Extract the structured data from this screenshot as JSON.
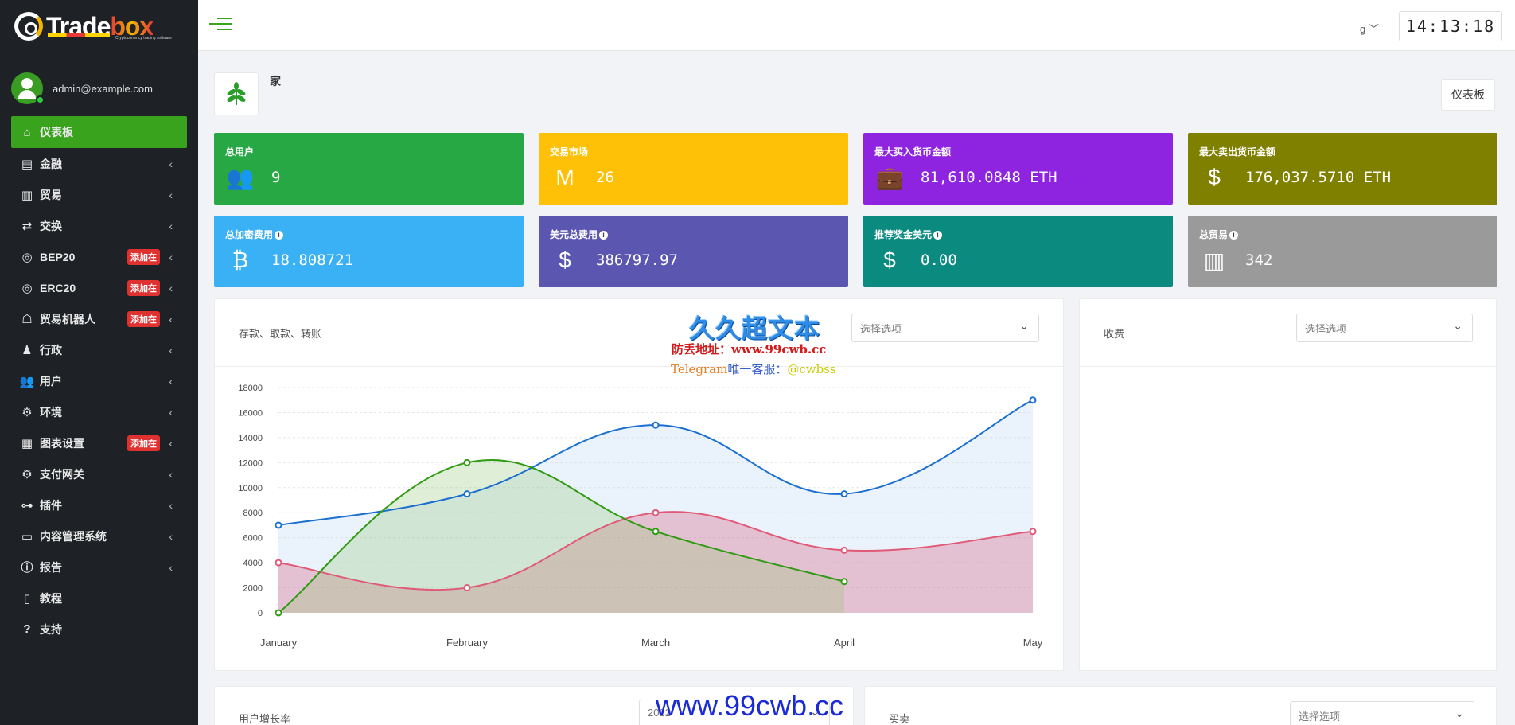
{
  "brand": {
    "name_part1": "Trade",
    "name_part2": "box",
    "tagline": "Cryptocurrency trading software"
  },
  "user": {
    "email": "admin@example.com"
  },
  "sidebar": {
    "items": [
      {
        "label": "仪表板",
        "icon": "home-icon",
        "badge": "",
        "active": true
      },
      {
        "label": "金融",
        "icon": "wallet-icon",
        "badge": ""
      },
      {
        "label": "贸易",
        "icon": "chart-bar-icon",
        "badge": ""
      },
      {
        "label": "交换",
        "icon": "exchange-icon",
        "badge": ""
      },
      {
        "label": "BEP20",
        "icon": "coins-icon",
        "badge": "添加在"
      },
      {
        "label": "ERC20",
        "icon": "coins-icon",
        "badge": "添加在"
      },
      {
        "label": "贸易机器人",
        "icon": "robot-icon",
        "badge": "添加在"
      },
      {
        "label": "行政",
        "icon": "user-tie-icon",
        "badge": ""
      },
      {
        "label": "用户",
        "icon": "users-icon",
        "badge": ""
      },
      {
        "label": "环境",
        "icon": "gear-icon",
        "badge": ""
      },
      {
        "label": "图表设置",
        "icon": "chart-icon",
        "badge": "添加在"
      },
      {
        "label": "支付网关",
        "icon": "cogs-icon",
        "badge": ""
      },
      {
        "label": "插件",
        "icon": "plugin-icon",
        "badge": ""
      },
      {
        "label": "内容管理系统",
        "icon": "message-icon",
        "badge": ""
      },
      {
        "label": "报告",
        "icon": "info-icon",
        "badge": ""
      },
      {
        "label": "教程",
        "icon": "file-icon",
        "badge": ""
      },
      {
        "label": "支持",
        "icon": "question-icon",
        "badge": ""
      }
    ]
  },
  "topbar": {
    "lang": "g",
    "clock": "14:13:18"
  },
  "page": {
    "breadcrumb": "家",
    "dashboard_button": "仪表板"
  },
  "cards": [
    {
      "title": "总用户",
      "value": "9",
      "color": "#28a745",
      "icon": "users-icon",
      "info": false
    },
    {
      "title": "交易市场",
      "value": "26",
      "color": "#ffc107",
      "icon": "market-icon",
      "info": false
    },
    {
      "title": "最大买入货币金额",
      "value": "81,610.0848 ETH",
      "color": "#8e24e0",
      "icon": "briefcase-icon",
      "info": false
    },
    {
      "title": "最大卖出货币金额",
      "value": "176,037.5710 ETH",
      "color": "#808000",
      "icon": "sell-icon",
      "info": false
    },
    {
      "title": "总加密费用",
      "value": "18.808721",
      "color": "#3ab0f5",
      "icon": "bitcoin-icon",
      "info": true
    },
    {
      "title": "美元总费用",
      "value": "386797.97",
      "color": "#5b57b0",
      "icon": "hand-dollar-icon",
      "info": true
    },
    {
      "title": "推荐奖金美元",
      "value": "0.00",
      "color": "#0b8a80",
      "icon": "dollar-icon",
      "info": true
    },
    {
      "title": "总贸易",
      "value": "342",
      "color": "#9a9a9a",
      "icon": "chart-bar-icon",
      "info": true
    }
  ],
  "panels": {
    "deposits": {
      "title": "存款、取款、转账",
      "select_placeholder": "选择选项"
    },
    "fees": {
      "title": "收费",
      "select_placeholder": "选择选项"
    },
    "growth": {
      "title": "用户增长率",
      "select_value": "2022"
    },
    "trade": {
      "title": "买卖",
      "select_placeholder": "选择选项"
    }
  },
  "chart_data": {
    "type": "area",
    "categories": [
      "January",
      "February",
      "March",
      "April",
      "May"
    ],
    "ylim": [
      0,
      18000
    ],
    "yticks": [
      0,
      2000,
      4000,
      6000,
      8000,
      10000,
      12000,
      14000,
      16000,
      18000
    ],
    "series": [
      {
        "values": [
          7000,
          9500,
          15000,
          9500,
          17000
        ],
        "color": "#1a6fd0",
        "fill": "rgba(170,205,240,0.25)"
      },
      {
        "values": [
          4000,
          2000,
          8000,
          5000,
          6500
        ],
        "color": "#e05a78",
        "fill": "rgba(215,80,115,0.30)"
      },
      {
        "values": [
          0,
          12000,
          6500,
          2500
        ],
        "color": "#2f9a12",
        "fill": "rgba(150,200,120,0.30)"
      }
    ]
  },
  "watermark": {
    "line1": "久久超文本",
    "line2": "防丢地址：www.99cwb.cc",
    "line3a": "Telegram",
    "line3b": "唯一客服：",
    "line3c": "@cwbss",
    "line4": "www.99cwb.cc"
  }
}
